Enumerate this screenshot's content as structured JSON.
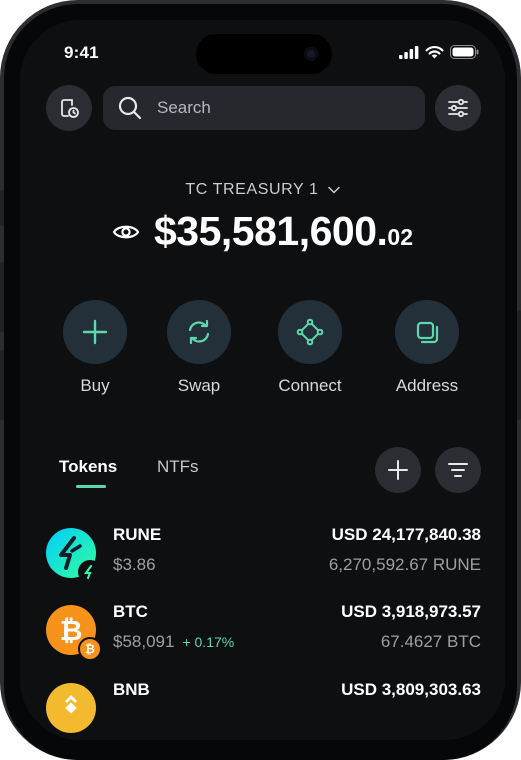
{
  "status_bar": {
    "time": "9:41"
  },
  "search": {
    "placeholder": "Search"
  },
  "wallet": {
    "name": "TC TREASURY 1",
    "balance_main": "$35,581,600.",
    "balance_cents": "02"
  },
  "actions": [
    {
      "label": "Buy",
      "icon": "plus-icon"
    },
    {
      "label": "Swap",
      "icon": "swap-icon"
    },
    {
      "label": "Connect",
      "icon": "connect-icon"
    },
    {
      "label": "Address",
      "icon": "address-icon"
    }
  ],
  "tabs": [
    {
      "label": "Tokens",
      "active": true
    },
    {
      "label": "NTFs",
      "active": false
    }
  ],
  "tokens": [
    {
      "symbol": "RUNE",
      "price": "$3.86",
      "change": "",
      "usd_value": "USD 24,177,840.38",
      "amount": "6,270,592.67 RUNE",
      "color": "#1fd6c4"
    },
    {
      "symbol": "BTC",
      "price": "$58,091",
      "change": "+ 0.17%",
      "usd_value": "USD 3,918,973.57",
      "amount": "67.4627 BTC",
      "color": "#f7931a"
    },
    {
      "symbol": "BNB",
      "price": "",
      "change": "",
      "usd_value": "USD 3,809,303.63",
      "amount": "",
      "color": "#f3ba2f"
    }
  ],
  "colors": {
    "accent": "#5dd8ad",
    "background": "#0e0f11"
  }
}
